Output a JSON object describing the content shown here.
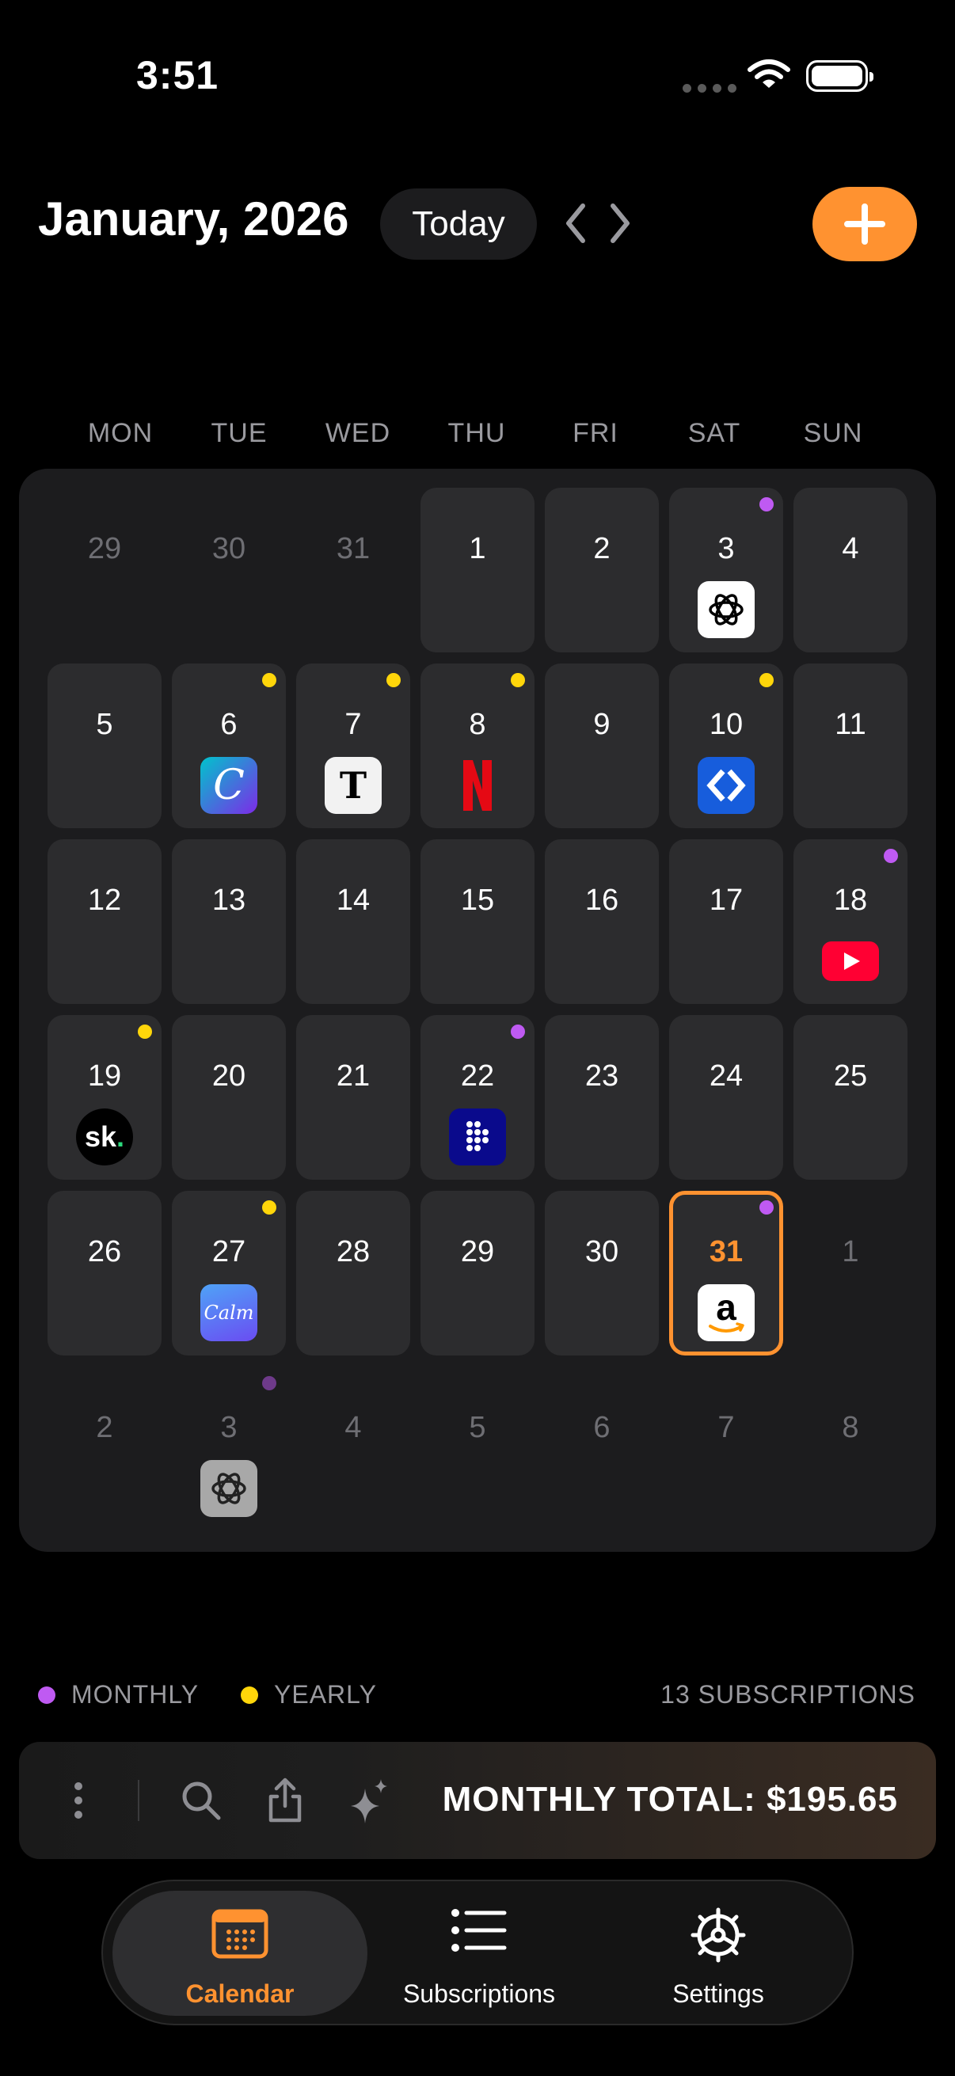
{
  "status": {
    "time": "3:51"
  },
  "header": {
    "month_year": "January, 2026",
    "today_label": "Today"
  },
  "weekdays": [
    "MON",
    "TUE",
    "WED",
    "THU",
    "FRI",
    "SAT",
    "SUN"
  ],
  "days": [
    {
      "num": "29"
    },
    {
      "num": "30"
    },
    {
      "num": "31"
    },
    {
      "num": "1"
    },
    {
      "num": "2"
    },
    {
      "num": "3"
    },
    {
      "num": "4"
    },
    {
      "num": "5"
    },
    {
      "num": "6"
    },
    {
      "num": "7"
    },
    {
      "num": "8"
    },
    {
      "num": "9"
    },
    {
      "num": "10"
    },
    {
      "num": "11"
    },
    {
      "num": "12"
    },
    {
      "num": "13"
    },
    {
      "num": "14"
    },
    {
      "num": "15"
    },
    {
      "num": "16"
    },
    {
      "num": "17"
    },
    {
      "num": "18"
    },
    {
      "num": "19"
    },
    {
      "num": "20"
    },
    {
      "num": "21"
    },
    {
      "num": "22"
    },
    {
      "num": "23"
    },
    {
      "num": "24"
    },
    {
      "num": "25"
    },
    {
      "num": "26"
    },
    {
      "num": "27"
    },
    {
      "num": "28"
    },
    {
      "num": "29"
    },
    {
      "num": "30"
    },
    {
      "num": "31"
    },
    {
      "num": "1"
    },
    {
      "num": "2"
    },
    {
      "num": "3"
    },
    {
      "num": "4"
    },
    {
      "num": "5"
    },
    {
      "num": "6"
    },
    {
      "num": "7"
    },
    {
      "num": "8"
    }
  ],
  "subscription_icons": {
    "d3": "openai-icon",
    "d6": "canva-icon",
    "d7": "nyt-icon",
    "d8": "netflix-icon",
    "d10": "bitwarden-icon",
    "d18": "youtube-icon",
    "d19": "sk-icon",
    "d22": "deezer-icon",
    "d27": "calm-icon",
    "d31": "amazon-icon",
    "next3": "openai-icon"
  },
  "legend": {
    "monthly": "MONTHLY",
    "yearly": "YEARLY",
    "count": "13 SUBSCRIPTIONS"
  },
  "colors": {
    "accent": "#ff9230",
    "monthly": "#bf5af2",
    "yearly": "#ffd60a"
  },
  "toolbar": {
    "total": "MONTHLY TOTAL: $195.65"
  },
  "tabs": [
    {
      "label": "Calendar",
      "icon": "calendar-icon"
    },
    {
      "label": "Subscriptions",
      "icon": "list-icon"
    },
    {
      "label": "Settings",
      "icon": "gear-icon"
    }
  ]
}
